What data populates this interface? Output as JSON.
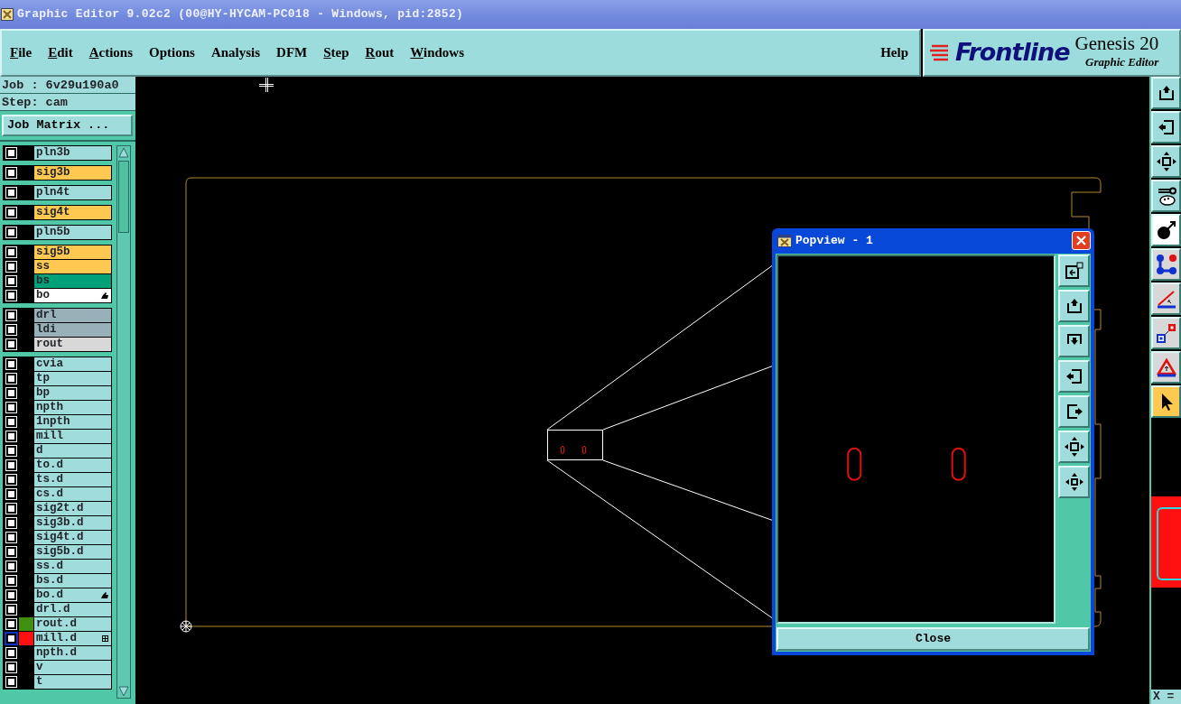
{
  "window": {
    "title": "Graphic Editor 9.02c2 (00@HY-HYCAM-PC018 - Windows, pid:2852)"
  },
  "menu": [
    {
      "label": "File",
      "underlined": true
    },
    {
      "label": "Edit",
      "underlined": true
    },
    {
      "label": "Actions",
      "underlined": true
    },
    {
      "label": "Options",
      "underlined": false
    },
    {
      "label": "Analysis",
      "underlined": false
    },
    {
      "label": "DFM",
      "underlined": false
    },
    {
      "label": "Step",
      "underlined": true
    },
    {
      "label": "Rout",
      "underlined": true
    },
    {
      "label": "Windows",
      "underlined": true
    }
  ],
  "help": {
    "label": "Help"
  },
  "brand": {
    "logo": "Frontline",
    "product": "Genesis 20",
    "subtitle": "Graphic Editor"
  },
  "job": {
    "job": "Job : 6v29u190a0",
    "step": "Step: cam",
    "matrix_button": "Job Matrix ..."
  },
  "layer_groups": [
    {
      "layers": [
        {
          "name": "pln3b",
          "color": "#a0dcdc",
          "selected": false
        }
      ]
    },
    {
      "layers": [
        {
          "name": "sig3b",
          "color": "#ffc850",
          "selected": false
        }
      ]
    },
    {
      "layers": [
        {
          "name": "pln4t",
          "color": "#a0dcdc",
          "selected": false
        }
      ]
    },
    {
      "layers": [
        {
          "name": "sig4t",
          "color": "#ffc850",
          "selected": false
        }
      ]
    },
    {
      "layers": [
        {
          "name": "pln5b",
          "color": "#a0dcdc",
          "selected": false
        }
      ]
    },
    {
      "layers": [
        {
          "name": "sig5b",
          "color": "#ffc850",
          "selected": false
        },
        {
          "name": "ss",
          "color": "#ffc850",
          "selected": false
        },
        {
          "name": "bs",
          "color": "#00a078",
          "selected": false
        },
        {
          "name": "bo",
          "color": "#ffffff",
          "selected": false,
          "icon": {
            "kind": "hand"
          }
        }
      ]
    },
    {
      "layers": [
        {
          "name": "drl",
          "color": "#98b0b8",
          "selected": false
        },
        {
          "name": "ldi",
          "color": "#98b0b8",
          "selected": false
        },
        {
          "name": "rout",
          "color": "#d8d8d8",
          "selected": false
        }
      ]
    },
    {
      "layers": [
        {
          "name": "cvia",
          "color": "#a0dcdc",
          "selected": false
        },
        {
          "name": "tp",
          "color": "#a0dcdc",
          "selected": false
        },
        {
          "name": "bp",
          "color": "#a0dcdc",
          "selected": false
        },
        {
          "name": "npth",
          "color": "#a0dcdc",
          "selected": false
        },
        {
          "name": "1npth",
          "color": "#a0dcdc",
          "selected": false
        },
        {
          "name": "mill",
          "color": "#a0dcdc",
          "selected": false
        },
        {
          "name": "d",
          "color": "#a0dcdc",
          "selected": false
        },
        {
          "name": "to.d",
          "color": "#a0dcdc",
          "selected": false
        },
        {
          "name": "ts.d",
          "color": "#a0dcdc",
          "selected": false
        },
        {
          "name": "cs.d",
          "color": "#a0dcdc",
          "selected": false
        },
        {
          "name": "sig2t.d",
          "color": "#a0dcdc",
          "selected": false
        },
        {
          "name": "sig3b.d",
          "color": "#a0dcdc",
          "selected": false
        },
        {
          "name": "sig4t.d",
          "color": "#a0dcdc",
          "selected": false
        },
        {
          "name": "sig5b.d",
          "color": "#a0dcdc",
          "selected": false
        },
        {
          "name": "ss.d",
          "color": "#a0dcdc",
          "selected": false
        },
        {
          "name": "bs.d",
          "color": "#a0dcdc",
          "selected": false
        },
        {
          "name": "bo.d",
          "color": "#a0dcdc",
          "selected": false,
          "icon": {
            "kind": "hand"
          }
        },
        {
          "name": "drl.d",
          "color": "#a0dcdc",
          "selected": false
        },
        {
          "name": "rout.d",
          "color": "#a0dcdc",
          "selected": false,
          "swatch": {
            "color": "#409010"
          }
        },
        {
          "name": "mill.d",
          "color": "#a0dcdc",
          "selected": true,
          "swatch": {
            "color": "#ff1010"
          },
          "icon": {
            "kind": "grid"
          }
        },
        {
          "name": "npth.d",
          "color": "#a0dcdc",
          "selected": false
        },
        {
          "name": "v",
          "color": "#a0dcdc",
          "selected": false
        },
        {
          "name": "t",
          "color": "#a0dcdc",
          "selected": false
        }
      ]
    }
  ],
  "toolbar": [
    {
      "kind": "up",
      "selected": false
    },
    {
      "kind": "left",
      "selected": false
    },
    {
      "kind": "fit",
      "selected": false
    },
    {
      "kind": "tools",
      "selected": false
    },
    {
      "kind": "snap",
      "selected": false
    },
    {
      "kind": "nodes",
      "selected": false
    },
    {
      "kind": "angle",
      "selected": false
    },
    {
      "kind": "squares",
      "selected": false
    },
    {
      "kind": "triangle",
      "selected": false
    },
    {
      "kind": "pointer",
      "selected": true
    }
  ],
  "popview": {
    "title": "Popview - 1",
    "tools": [
      {
        "kind": "home"
      },
      {
        "kind": "up"
      },
      {
        "kind": "down"
      },
      {
        "kind": "left"
      },
      {
        "kind": "right"
      },
      {
        "kind": "fit"
      },
      {
        "kind": "spread"
      }
    ],
    "close": "Close"
  },
  "status": {
    "x_label": "X ="
  }
}
